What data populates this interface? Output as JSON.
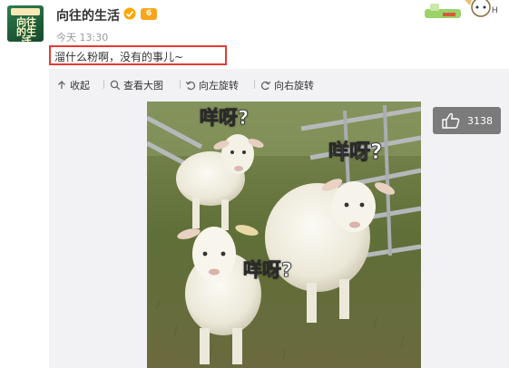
{
  "user": {
    "name": "向往的生活",
    "avatar_text": "向往的生活",
    "level": "6"
  },
  "post": {
    "time": "今天 13:30",
    "text": "溜什么粉啊，没有的事儿~"
  },
  "toolbar": {
    "collapse": "收起",
    "view_large": "查看大图",
    "rotate_left": "向左旋转",
    "rotate_right": "向右旋转"
  },
  "image": {
    "captions": [
      "咩呀?",
      "咩呀?",
      "咩呀?"
    ]
  },
  "like": {
    "count": "3138"
  },
  "colors": {
    "highlight_border": "#e53935",
    "verified": "#ffa500",
    "media_bg": "#f2f2f5"
  }
}
